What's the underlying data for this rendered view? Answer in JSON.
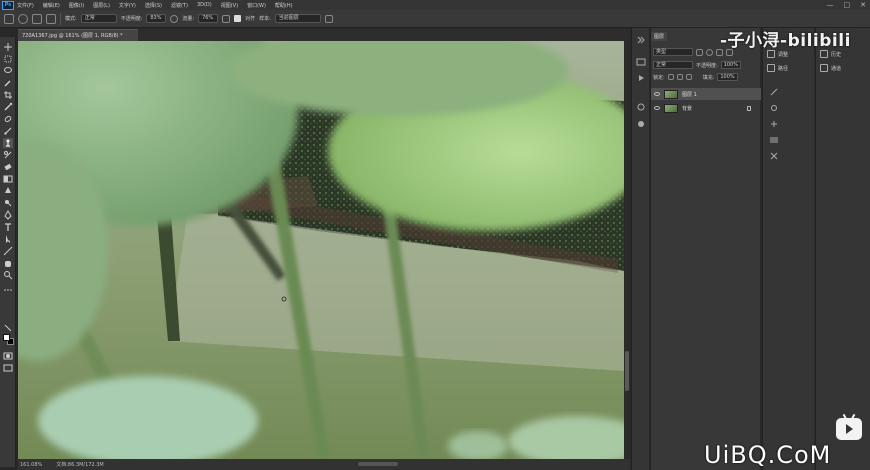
{
  "app": {
    "logo": "Ps"
  },
  "menu": [
    "文件(F)",
    "编辑(E)",
    "图像(I)",
    "图层(L)",
    "文字(Y)",
    "选择(S)",
    "滤镜(T)",
    "3D(D)",
    "视图(V)",
    "窗口(W)",
    "帮助(H)"
  ],
  "window_controls": [
    "—",
    "□",
    "✕"
  ],
  "options": {
    "mode_label": "模式:",
    "mode_value": "正常",
    "opacity_label": "不透明度:",
    "opacity_value": "83%",
    "flow_label": "流量:",
    "flow_value": "76%",
    "aligned_label": "对齐",
    "sample_label": "样本:",
    "sample_value": "当前图层"
  },
  "document": {
    "tab_title": "720A1367.jpg @ 161% (图层 1, RGB/8) *"
  },
  "status": {
    "zoom": "161.08%",
    "doc": "文档:86.3M/172.3M"
  },
  "layers_panel": {
    "tab_label": "图层",
    "kind_label": "类型",
    "blend_mode": "正常",
    "opacity_label": "不透明度:",
    "opacity_value": "100%",
    "lock_label": "锁定:",
    "fill_label": "填充:",
    "fill_value": "100%",
    "layers": [
      {
        "name": "图层 1",
        "active": true
      },
      {
        "name": "背景",
        "active": false
      }
    ]
  },
  "side_panels": {
    "adjust": "调整",
    "paths": "路径",
    "history": "历史",
    "channels": "通道"
  },
  "watermark": {
    "bilibili": "-子小浔-bilibili",
    "uibq": "UiBQ.CoM"
  },
  "colors": {
    "foreground": "#ffffff",
    "background": "#000000",
    "accent": "#31a8ff"
  }
}
